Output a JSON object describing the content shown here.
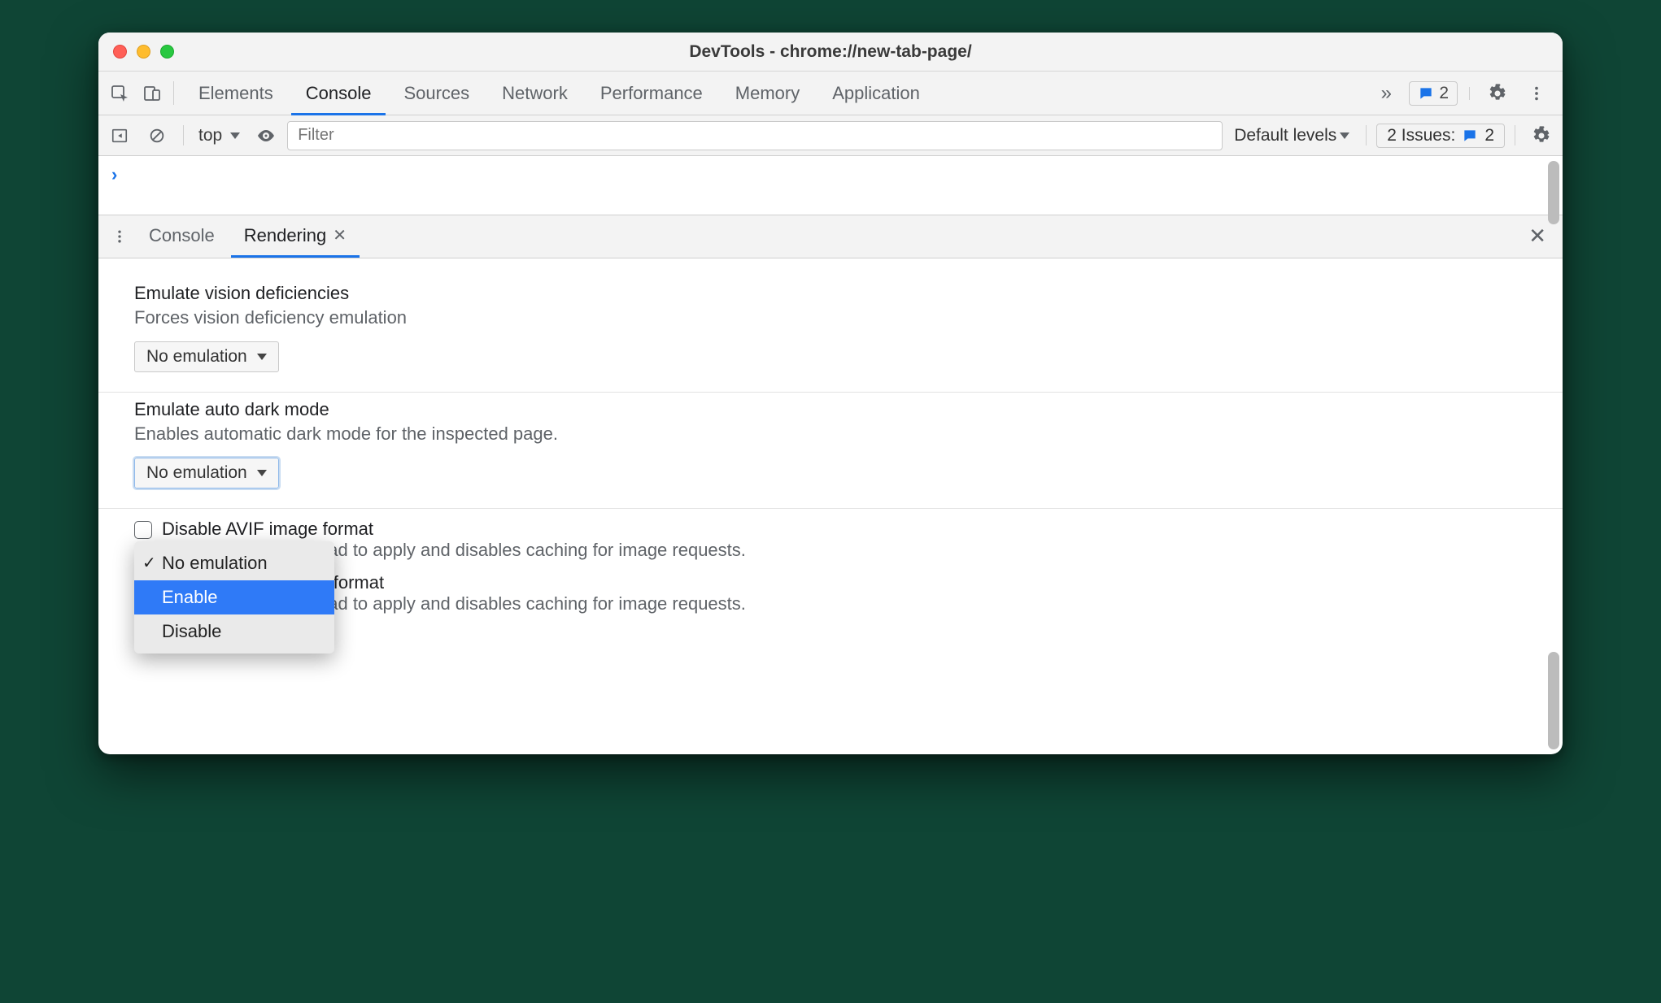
{
  "window": {
    "title": "DevTools - chrome://new-tab-page/"
  },
  "mainTabs": {
    "items": [
      "Elements",
      "Console",
      "Sources",
      "Network",
      "Performance",
      "Memory",
      "Application"
    ],
    "activeIndex": 1,
    "moreGlyph": "»",
    "badgeCount": "2"
  },
  "consoleBar": {
    "context": "top",
    "filterPlaceholder": "Filter",
    "levels": "Default levels",
    "issuesLabel": "2 Issues:",
    "issuesCount": "2"
  },
  "consoleBody": {
    "promptGlyph": "›"
  },
  "drawer": {
    "tabs": [
      {
        "label": "Console",
        "active": false
      },
      {
        "label": "Rendering",
        "active": true
      }
    ]
  },
  "rendering": {
    "vision": {
      "title": "Emulate vision deficiencies",
      "desc": "Forces vision deficiency emulation",
      "selected": "No emulation"
    },
    "darkmode": {
      "title": "Emulate auto dark mode",
      "desc": "Enables automatic dark mode for the inspected page.",
      "selected": "No emulation",
      "options": [
        "No emulation",
        "Enable",
        "Disable"
      ],
      "highlightedIndex": 1,
      "checkedIndex": 0
    },
    "check1": {
      "title": "Disable AVIF image format",
      "desc": "Requires a page reload to apply and disables caching for image requests."
    },
    "check2": {
      "title": "Disable WebP image format",
      "desc": "Requires a page reload to apply and disables caching for image requests."
    }
  }
}
